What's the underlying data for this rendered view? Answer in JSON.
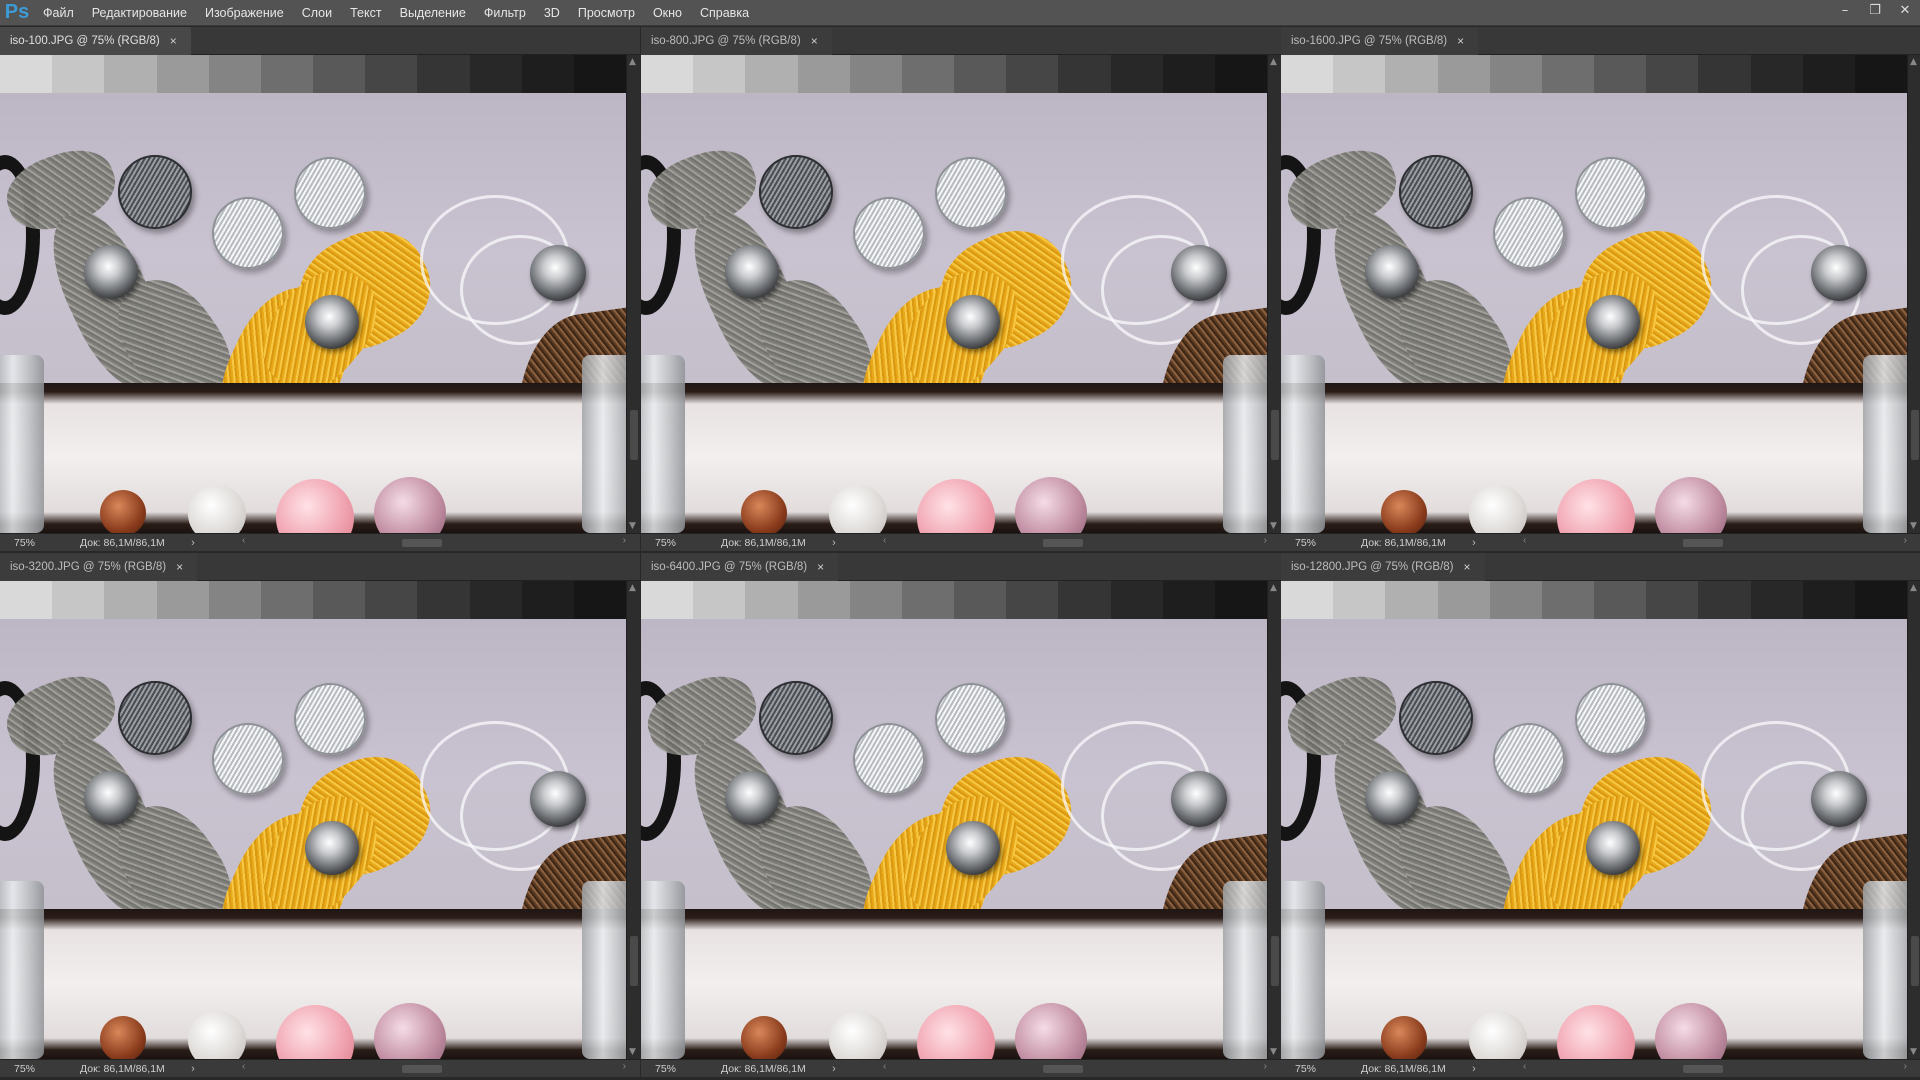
{
  "app": {
    "logo": "Ps"
  },
  "menu": [
    "Файл",
    "Редактирование",
    "Изображение",
    "Слои",
    "Текст",
    "Выделение",
    "Фильтр",
    "3D",
    "Просмотр",
    "Окно",
    "Справка"
  ],
  "window_controls": {
    "minimize": "–",
    "restore": "❐",
    "close": "✕"
  },
  "documents": [
    {
      "title": "iso-100.JPG @ 75% (RGB/8)",
      "zoom": "75%",
      "doc_info": "Док: 86,1M/86,1M",
      "active": true
    },
    {
      "title": "iso-800.JPG @ 75% (RGB/8)",
      "zoom": "75%",
      "doc_info": "Док: 86,1M/86,1M",
      "active": false
    },
    {
      "title": "iso-1600.JPG @ 75% (RGB/8)",
      "zoom": "75%",
      "doc_info": "Док: 86,1M/86,1M",
      "active": false
    },
    {
      "title": "iso-3200.JPG @ 75% (RGB/8)",
      "zoom": "75%",
      "doc_info": "Док: 86,1M/86,1M",
      "active": false
    },
    {
      "title": "iso-6400.JPG @ 75% (RGB/8)",
      "zoom": "75%",
      "doc_info": "Док: 86,1M/86,1M",
      "active": false
    },
    {
      "title": "iso-12800.JPG @ 75% (RGB/8)",
      "zoom": "75%",
      "doc_info": "Док: 86,1M/86,1M",
      "active": false
    }
  ],
  "icons": {
    "close_tab": "×",
    "status_arrow": "›",
    "scroll_left": "‹",
    "scroll_right": "›"
  },
  "colors": {
    "menubar": "#535353",
    "workspace": "#282828",
    "ps_blue": "#3d9bd6"
  }
}
